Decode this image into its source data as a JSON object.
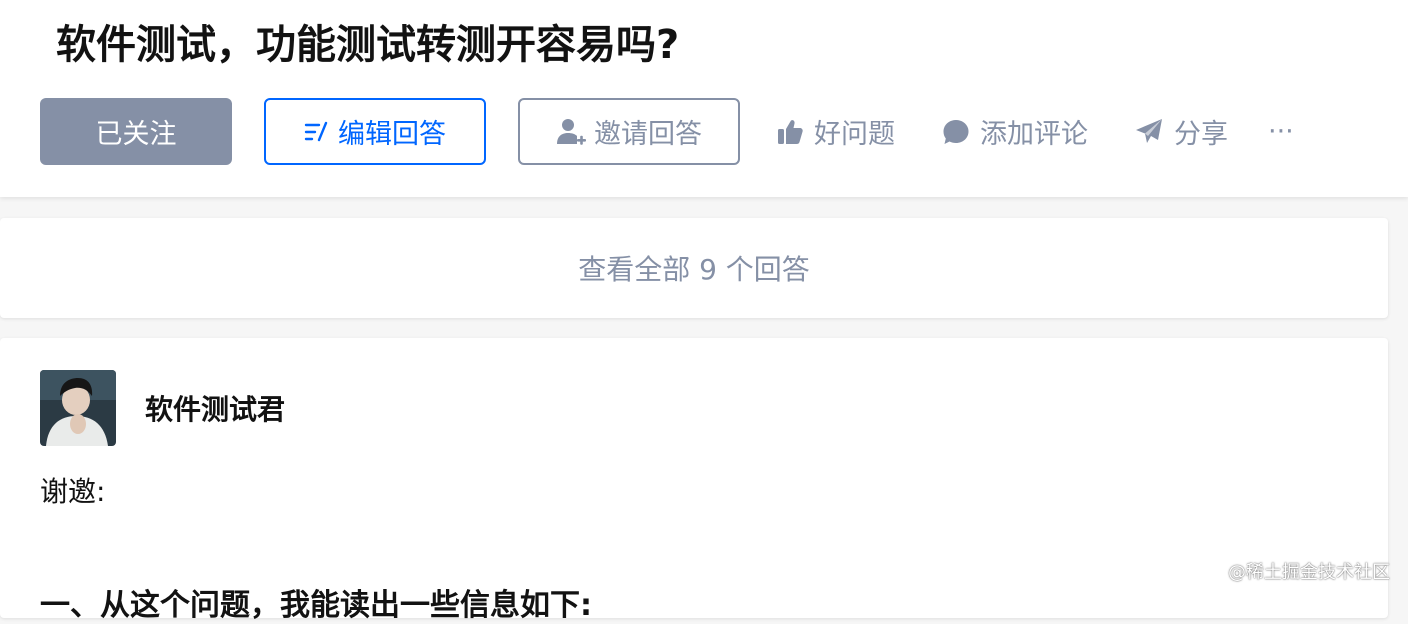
{
  "question": {
    "title": "软件测试，功能测试转测开容易吗?"
  },
  "actions": {
    "follow_label": "已关注",
    "edit_answer_label": "编辑回答",
    "invite_answer_label": "邀请回答",
    "good_question_label": "好问题",
    "add_comment_label": "添加评论",
    "share_label": "分享",
    "more_label": "···"
  },
  "answers": {
    "view_all_label": "查看全部 9 个回答"
  },
  "answer": {
    "author_name": "软件测试君",
    "greeting": "谢邀:",
    "heading": "一、从这个问题，我能读出一些信息如下:"
  },
  "watermark": "@稀土掘金技术社区",
  "colors": {
    "primary_blue": "#0066ff",
    "muted_gray": "#8590a6",
    "text_dark": "#121212",
    "background": "#f6f6f6"
  },
  "icons": {
    "edit": "edit-pencil-icon",
    "invite": "add-user-icon",
    "good_question": "thumbs-up-icon",
    "comment": "comment-bubble-icon",
    "share": "paper-plane-icon"
  }
}
